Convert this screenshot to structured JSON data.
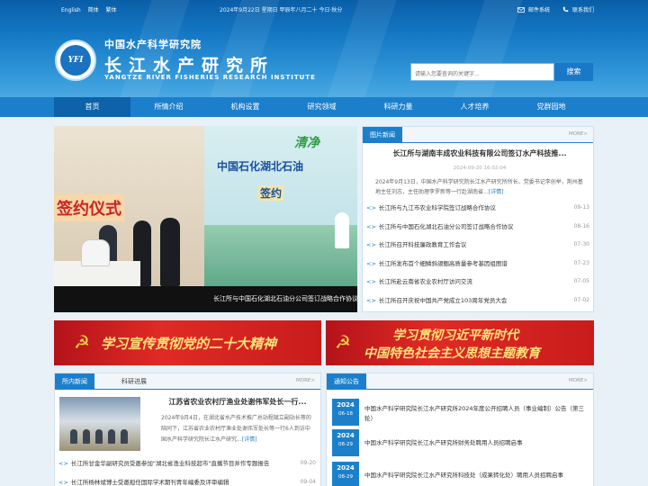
{
  "topbar": {
    "lang": [
      "English",
      "简体",
      "繁体"
    ],
    "date": "2024年9月22日 星期日 甲辰年八月二十 今日·秋分",
    "links": [
      {
        "icon": "mail-icon",
        "label": "邮件系统"
      },
      {
        "icon": "phone-icon",
        "label": "联系我们"
      }
    ]
  },
  "brand": {
    "logo_text": "YFI",
    "name_parent": "中国水产科学研究院",
    "name_cn": "长江水产研究所",
    "name_en": "YANGTZE RIVER FISHERIES RESEARCH INSTITUTE"
  },
  "search": {
    "placeholder": "请输入您要查询的关键字...",
    "button": "搜索"
  },
  "nav": [
    "首页",
    "所情介绍",
    "机构设置",
    "研究领域",
    "科研力量",
    "人才培养",
    "党群园地"
  ],
  "slider": {
    "sign_text": "签约仪式",
    "slogan": "清净",
    "headline_1": "中国石化湖北石油",
    "headline_2": "签约",
    "caption": "长江所与中国石化湖北石油分公司签订战略合作协议",
    "dots": 4,
    "active_dot": 2
  },
  "picture_news": {
    "tab": "图片新闻",
    "more": "MORE>",
    "title": "长江所与湖南丰成农业科技有限公司签订水产科技推...",
    "time": "2024-09-20 16:02:04",
    "summary": "2024年9月13日，中国水产科学研究院长江水产研究所所长、党委书记李创举，荆州基地主任刘志，主任助理李罗新等一行赴湖南省...",
    "detail": "[详情]",
    "items": [
      {
        "title": "长江所与九江市农业科学院签订战略合作协议",
        "date": "09-13"
      },
      {
        "title": "长江所与中国石化湖北石油分公司签订战略合作协议",
        "date": "08-16"
      },
      {
        "title": "长江所召开科技廉政教育工作会议",
        "date": "07-30"
      },
      {
        "title": "长江所发布首个细鳞斜颌鲴高质量参考基因组图谱",
        "date": "07-23"
      },
      {
        "title": "长江所赴云南省农业农村厅访问交流",
        "date": "07-05"
      },
      {
        "title": "长江所召开庆祝中国共产党成立103周年党员大会",
        "date": "07-02"
      }
    ]
  },
  "banners": [
    {
      "text": "学习宣传贯彻党的二十大精神"
    },
    {
      "line1": "学习贯彻习近平新时代",
      "line2": "中国特色社会主义思想主题教育"
    }
  ],
  "institute_news": {
    "tabs": [
      "所内新闻",
      "科研进展"
    ],
    "more": "MORE>",
    "title": "江苏省农业农村厅渔业处谢伟军处长一行...",
    "summary": "2024年9月4日，在湖北省水产技术推广总站程斌立副站长等的陪同下，江苏省农业农村厅渔业处谢伟军处长等一行6人到访中国水产科学研究院长江水产研究...",
    "detail": "[详情]",
    "items": [
      {
        "title": "长江所甘金华副研究员受邀参加\"湖北省渔业科技超市\"直播节目并作专题报告",
        "date": "09-20"
      },
      {
        "title": "长江所杨林斌博士受邀担任国际学术期刊青年编委及评审编辑",
        "date": "09-04"
      }
    ]
  },
  "notices": {
    "tab": "通知公告",
    "more": "MORE>",
    "items": [
      {
        "year": "2024",
        "md": "06-18",
        "title": "中国水产科学研究院长江水产研究所2024年度公开招聘人员（事业编制）公告（第三轮）"
      },
      {
        "year": "2024",
        "md": "08-29",
        "title": "中国水产科学研究院长江水产研究所财务处聘用人员招聘启事"
      },
      {
        "year": "2024",
        "md": "08-29",
        "title": "中国水产科学研究院长江水产研究所科技处（成果转化处）聘用人员招聘启事"
      }
    ]
  }
}
